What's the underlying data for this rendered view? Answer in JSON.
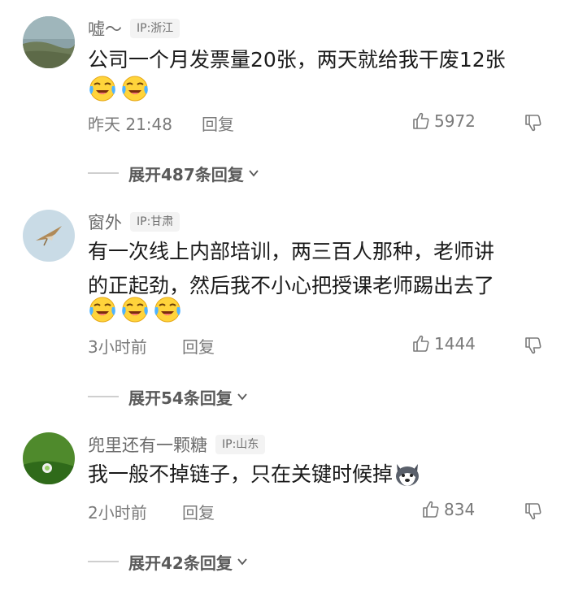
{
  "comments": [
    {
      "username": "嘘～",
      "ip": "IP:浙江",
      "lines": [
        "公司一个月发票量20张，两天就给我干废12张"
      ],
      "emojis": [
        "crying-laughing-emoji",
        "crying-laughing-emoji"
      ],
      "time": "昨天 21:48",
      "reply_label": "回复",
      "likes": "5972",
      "expand_label": "展开487条回复"
    },
    {
      "username": "窗外",
      "ip": "IP:甘肃",
      "lines": [
        "有一次线上内部培训，两三百人那种，老师讲",
        "的正起劲，然后我不小心把授课老师踢出去了"
      ],
      "emojis": [
        "crying-laughing-emoji",
        "crying-laughing-emoji",
        "crying-laughing-emoji"
      ],
      "time": "3小时前",
      "reply_label": "回复",
      "likes": "1444",
      "expand_label": "展开54条回复"
    },
    {
      "username": "兜里还有一颗糖",
      "ip": "IP:山东",
      "lines": [
        "我一般不掉链子，只在关键时候掉"
      ],
      "emojis": [
        "husky-dog-emoji"
      ],
      "time": "2小时前",
      "reply_label": "回复",
      "likes": "834",
      "expand_label": "展开42条回复"
    }
  ]
}
